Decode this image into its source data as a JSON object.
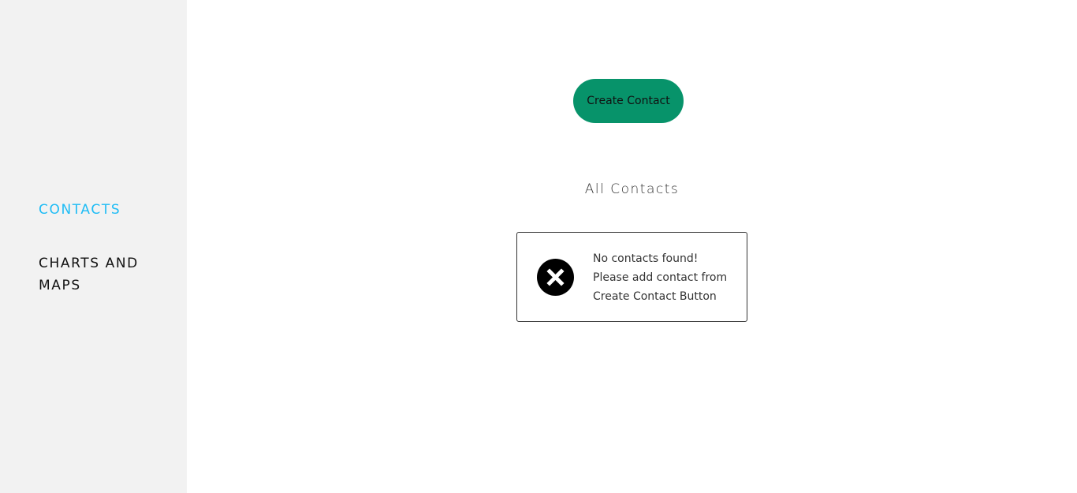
{
  "sidebar": {
    "items": [
      {
        "label": "CONTACTS",
        "active": true
      },
      {
        "label": "CHARTS AND MAPS",
        "active": false
      }
    ],
    "active_color": "#1ebcf5"
  },
  "main": {
    "create_button": "Create Contact",
    "button_color": "#07936a",
    "heading": "All Contacts",
    "empty": {
      "icon": "close-circle-icon",
      "lines": [
        "No contacts found!",
        "Please add contact from",
        "Create Contact Button"
      ]
    }
  }
}
